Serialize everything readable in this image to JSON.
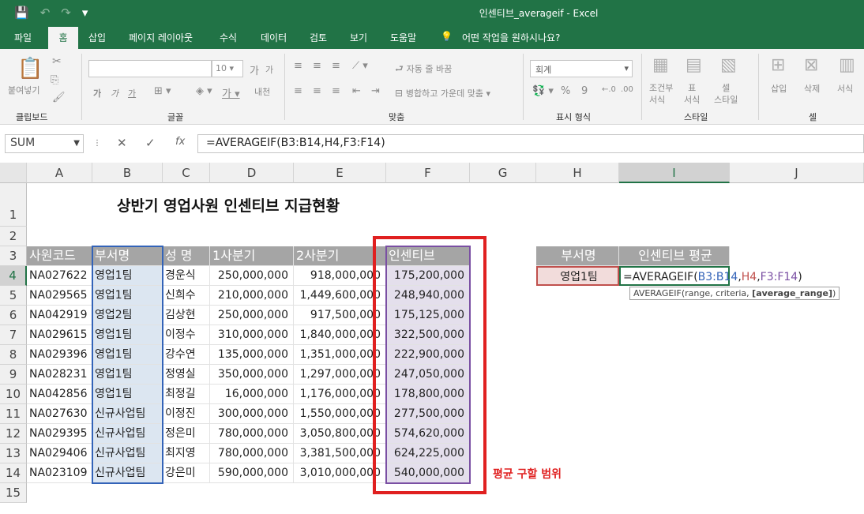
{
  "titlebar": {
    "title": "인센티브_averageif  -  Excel",
    "save_icon": "💾",
    "undo": "↶",
    "redo": "↷",
    "more": "▾"
  },
  "tabs": [
    "파일",
    "홈",
    "삽입",
    "페이지 레이아웃",
    "수식",
    "데이터",
    "검토",
    "보기",
    "도움말",
    "어떤 작업을 원하시나요?"
  ],
  "ribbon": {
    "clipboard": {
      "paste": "붙여넣기",
      "label": "클립보드"
    },
    "font": {
      "size": "10",
      "label": "글꼴",
      "grow": "가",
      "shrink": "가",
      "bold": "가",
      "italic": "가",
      "underline": "가",
      "phonetic": "내천"
    },
    "align": {
      "wrap": "자동 줄 바꿈",
      "merge": "병합하고 가운데 맞춤",
      "label": "맞춤"
    },
    "number": {
      "format": "회계",
      "label": "표시 형식",
      "percent": "%"
    },
    "style": {
      "cond": "조건부\n서식",
      "table": "표\n서식",
      "cell": "셀\n스타일",
      "label": "스타일"
    },
    "cells": {
      "insert": "삽입",
      "delete": "삭제",
      "format": "서식",
      "label": "셀"
    }
  },
  "formula_bar": {
    "name_box": "SUM",
    "cancel": "✕",
    "enter": "✓",
    "fx": "fx",
    "formula": "=AVERAGEIF(B3:B14,H4,F3:F14)"
  },
  "columns": [
    "A",
    "B",
    "C",
    "D",
    "E",
    "F",
    "G",
    "H",
    "I",
    "J"
  ],
  "rows": [
    "1",
    "2",
    "3",
    "4",
    "5",
    "6",
    "7",
    "8",
    "9",
    "10",
    "11",
    "12",
    "13",
    "14",
    "15"
  ],
  "sheet": {
    "banner": "상반기 영업사원 인센티브 지급현황",
    "headers": [
      "사원코드",
      "부서명",
      "성  명",
      "1사분기",
      "2사분기",
      "인센티브"
    ],
    "records": [
      [
        "NA027622",
        "영업1팀",
        "경운식",
        "250,000,000",
        "918,000,000",
        "175,200,000"
      ],
      [
        "NA029565",
        "영업1팀",
        "신희수",
        "210,000,000",
        "1,449,600,000",
        "248,940,000"
      ],
      [
        "NA042919",
        "영업2팀",
        "김상현",
        "250,000,000",
        "917,500,000",
        "175,125,000"
      ],
      [
        "NA029615",
        "영업1팀",
        "이정수",
        "310,000,000",
        "1,840,000,000",
        "322,500,000"
      ],
      [
        "NA029396",
        "영업1팀",
        "강수연",
        "135,000,000",
        "1,351,000,000",
        "222,900,000"
      ],
      [
        "NA028231",
        "영업1팀",
        "정영실",
        "350,000,000",
        "1,297,000,000",
        "247,050,000"
      ],
      [
        "NA042856",
        "영업1팀",
        "최정길",
        "16,000,000",
        "1,176,000,000",
        "178,800,000"
      ],
      [
        "NA027630",
        "신규사업팀",
        "이정진",
        "300,000,000",
        "1,550,000,000",
        "277,500,000"
      ],
      [
        "NA029395",
        "신규사업팀",
        "정은미",
        "780,000,000",
        "3,050,800,000",
        "574,620,000"
      ],
      [
        "NA029406",
        "신규사업팀",
        "최지영",
        "780,000,000",
        "3,381,500,000",
        "624,225,000"
      ],
      [
        "NA023109",
        "신규사업팀",
        "강은미",
        "590,000,000",
        "3,010,000,000",
        "540,000,000"
      ]
    ],
    "side_headers": [
      "부서명",
      "인센티브 평균"
    ],
    "criteria_value": "영업1팀",
    "edit_formula": {
      "prefix": "=AVERAGEIF(",
      "range": "B3:B14",
      "comma1": ",",
      "criteria": "H4",
      "comma2": ",",
      "avg": "F3:F14",
      "suffix": ")"
    },
    "tooltip": {
      "text": "AVERAGEIF(range, criteria, ",
      "bold": "[average_range]",
      "end": ")"
    },
    "annotation": "평균 구할 범위"
  }
}
